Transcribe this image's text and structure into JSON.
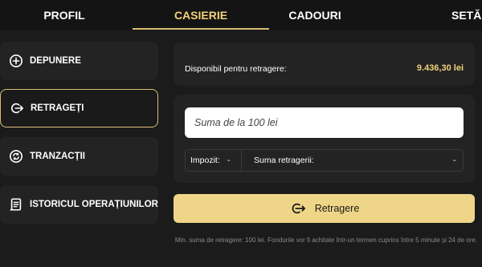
{
  "colors": {
    "accent": "#f1d27a",
    "button": "#efd587",
    "background": "#1b1b1b",
    "panel": "#232323"
  },
  "nav": {
    "tabs": [
      {
        "label": "PROFIL"
      },
      {
        "label": "CASIERIE",
        "active": true
      },
      {
        "label": "CADOURI"
      },
      {
        "label": "SETĂ"
      }
    ]
  },
  "sidebar": {
    "items": [
      {
        "label": "DEPUNERE",
        "icon": "plus-circle-icon"
      },
      {
        "label": "RETRAGEȚI",
        "icon": "withdraw-arrow-icon",
        "active": true
      },
      {
        "label": "TRANZACȚII",
        "icon": "transactions-cycle-icon"
      },
      {
        "label": "ISTORICUL OPERAȚIUNILOR",
        "icon": "history-document-icon"
      }
    ]
  },
  "withdraw": {
    "available_label": "Disponibil pentru retragere:",
    "available_value": "9.436,30 lei",
    "amount_placeholder": "Suma de la 100 lei",
    "tax_label": "Impozit:",
    "tax_value": "-",
    "withdraw_amount_label": "Suma retragerii:",
    "withdraw_amount_value": "-",
    "button_label": "Retragere",
    "note": "Min. suma de retragere: 100 lei. Fondurile vor fi achitate într-un termen cuprins între 5 minute și 24 de ore."
  }
}
